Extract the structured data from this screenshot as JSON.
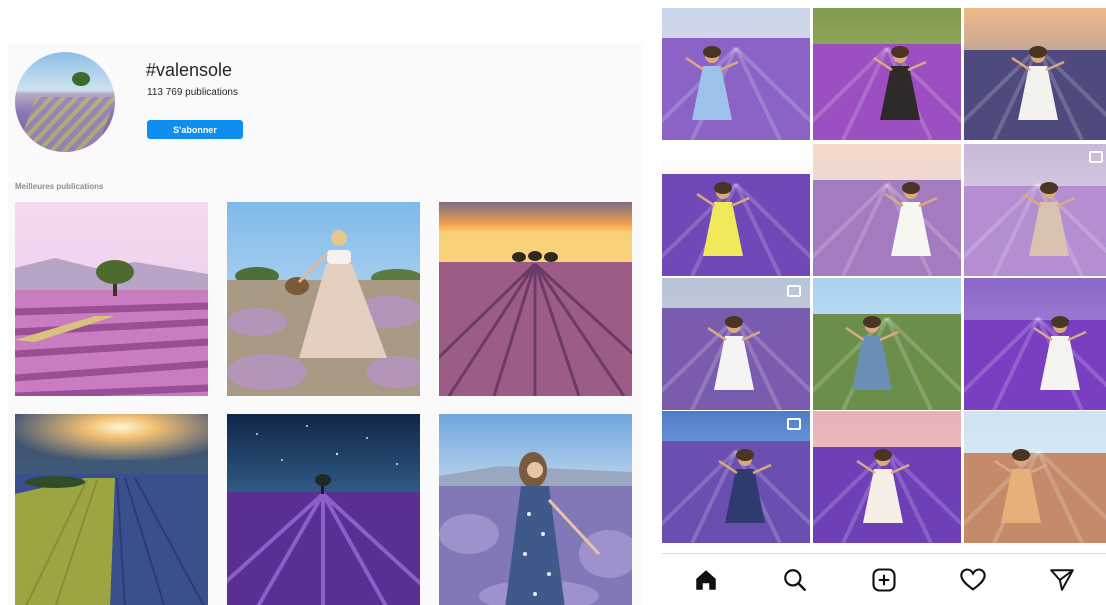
{
  "hashtag_page": {
    "hashtag": "#valensole",
    "post_count": "113 769 publications",
    "follow_button": "S'abonner",
    "top_posts_label": "Meilleures publications",
    "top_posts": [
      {
        "subject": "lavender field with lone tree"
      },
      {
        "subject": "woman in tulle skirt with basket"
      },
      {
        "subject": "lavender rows at sunset with trees"
      },
      {
        "subject": "sunburst over lavender and wheat fields"
      },
      {
        "subject": "starry night over lavender field"
      },
      {
        "subject": "woman in blue dress in lavender"
      }
    ]
  },
  "mobile_feed": {
    "tiles": [
      {
        "subject": "woman in floral dress"
      },
      {
        "subject": "lavender rows with person"
      },
      {
        "subject": "woman by tree at dusk"
      },
      {
        "subject": "woman in yellow dress with hat"
      },
      {
        "subject": "woman in white dress"
      },
      {
        "subject": "woman among lavender",
        "multi": true
      },
      {
        "subject": "woman with flowing hair",
        "multi": true
      },
      {
        "subject": "person near trees"
      },
      {
        "subject": "woman with hat and tree"
      },
      {
        "subject": "woman in floral dress with hat",
        "multi": true
      },
      {
        "subject": "woman with hat in field"
      },
      {
        "subject": "woman by heart-shaped tree"
      }
    ],
    "tabbar": {
      "icons": [
        "home-icon",
        "search-icon",
        "add-post-icon",
        "heart-icon",
        "direct-send-icon"
      ]
    }
  },
  "colors": {
    "follow_button": "#0e8ef0",
    "lavender": "#8a5fc0",
    "panel_background": "#fafafa"
  }
}
